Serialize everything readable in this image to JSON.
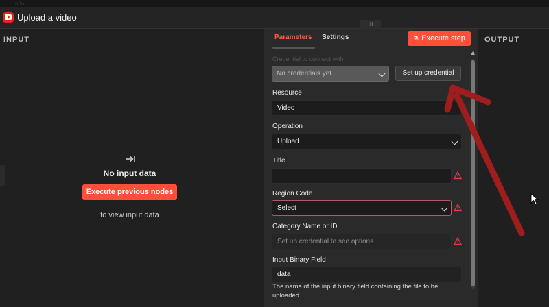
{
  "window": {
    "title": "Upload a video",
    "app_icon": "youtube-icon",
    "top_strip_text": "n8n"
  },
  "input_panel": {
    "label": "INPUT",
    "empty_title": "No input data",
    "execute_button": "Execute previous nodes",
    "subtitle": "to view input data"
  },
  "parameters_panel": {
    "tabs": [
      {
        "label": "Parameters"
      },
      {
        "label": "Settings"
      }
    ],
    "execute_step": "Execute step",
    "credential": {
      "label": "Credential to connect with",
      "select_value": "No credentials yet",
      "setup_button": "Set up credential"
    },
    "fields": {
      "resource": {
        "label": "Resource",
        "value": "Video"
      },
      "operation": {
        "label": "Operation",
        "value": "Upload"
      },
      "title": {
        "label": "Title",
        "value": ""
      },
      "region_code": {
        "label": "Region Code",
        "value": "Select"
      },
      "category": {
        "label": "Category Name or ID",
        "placeholder": "Set up credential to see options"
      },
      "binary_field": {
        "label": "Input Binary Field",
        "value": "data",
        "hint": "The name of the input binary field containing the file to be uploaded"
      }
    }
  },
  "output_panel": {
    "label": "OUTPUT"
  },
  "colors": {
    "accent": "#ff4f3a",
    "warning": "#e0404a",
    "annotation_arrow": "#a01d1d"
  }
}
